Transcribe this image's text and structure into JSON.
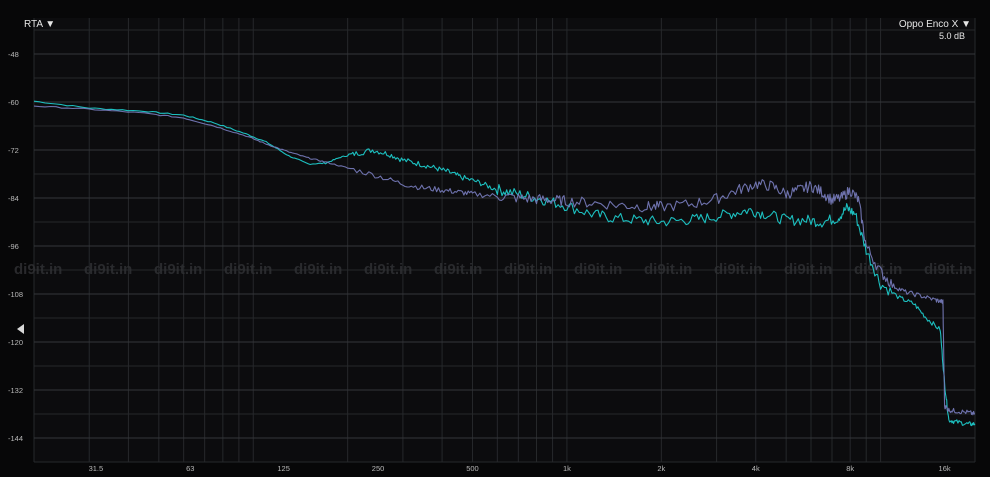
{
  "header": {
    "rta_label": "RTA ▼",
    "device_label": "Oppo Enco X ▼",
    "scale_label": "5.0 dB"
  },
  "watermark": {
    "text": "di9it.in"
  },
  "colors": {
    "background": "#070708",
    "grid": "#26282b",
    "series1": "#1ec9c9",
    "series2": "#7478b6",
    "tick_text": "#b8b8b8"
  },
  "chart_data": {
    "type": "line",
    "xscale": "log",
    "xlim": [
      20,
      20000
    ],
    "ylim": [
      -150,
      -39
    ],
    "grid": true,
    "x_ticks": [
      31.5,
      63,
      125,
      250,
      500,
      1000,
      2000,
      4000,
      8000,
      16000
    ],
    "x_tick_labels": [
      "31.5",
      "63",
      "125",
      "250",
      "500",
      "1k",
      "2k",
      "4k",
      "8k",
      "16k"
    ],
    "y_ticks": [
      -48,
      -60,
      -72,
      -84,
      -96,
      -108,
      -120,
      -132,
      -144
    ],
    "y_tick_labels": [
      "-48",
      "-60",
      "-72",
      "-84",
      "-96",
      "-108",
      "-120",
      "-132",
      "-144"
    ],
    "series": [
      {
        "color": "#1ec9c9",
        "x": [
          20,
          30,
          45,
          60,
          75,
          95,
          110,
          130,
          150,
          170,
          190,
          210,
          240,
          270,
          300,
          340,
          380,
          420,
          460,
          520,
          580,
          650,
          750,
          850,
          1000,
          1200,
          1400,
          1700,
          2000,
          2400,
          2800,
          3300,
          3800,
          4300,
          5000,
          5800,
          6500,
          7300,
          7800,
          8300,
          9000,
          10000,
          11500,
          12800,
          14000,
          15500,
          16000,
          16500,
          17500,
          19000,
          20000
        ],
        "y": [
          -59.8,
          -61.5,
          -62.3,
          -63.3,
          -65.2,
          -68.0,
          -70.0,
          -73.5,
          -75.5,
          -75.3,
          -73.8,
          -73.0,
          -72.0,
          -73.0,
          -74.5,
          -75.5,
          -76.5,
          -77.5,
          -78.8,
          -80.0,
          -81.5,
          -82.5,
          -83.5,
          -84.5,
          -86.0,
          -88.0,
          -89.0,
          -89.5,
          -90.0,
          -89.5,
          -89.0,
          -88.0,
          -87.0,
          -88.0,
          -89.5,
          -89.5,
          -90.0,
          -89.0,
          -86.5,
          -88.0,
          -97.0,
          -105.5,
          -109.0,
          -110.5,
          -114.0,
          -117.0,
          -130.5,
          -139.5,
          -140.0,
          -140.5,
          -140.5
        ]
      },
      {
        "color": "#7478b6",
        "x": [
          20,
          30,
          45,
          60,
          75,
          95,
          110,
          130,
          150,
          170,
          200,
          250,
          300,
          350,
          400,
          450,
          500,
          600,
          700,
          800,
          900,
          1000,
          1200,
          1500,
          1800,
          2000,
          2500,
          3000,
          3500,
          4000,
          4500,
          5000,
          5500,
          6000,
          6500,
          7000,
          7500,
          8000,
          8500,
          9000,
          10000,
          11000,
          12000,
          13500,
          15000,
          15800,
          16000,
          16500,
          17500,
          19000,
          20000
        ],
        "y": [
          -61.0,
          -61.8,
          -62.8,
          -64.0,
          -66.0,
          -68.5,
          -70.5,
          -72.5,
          -74.0,
          -75.0,
          -76.5,
          -78.5,
          -80.5,
          -81.5,
          -82.0,
          -82.5,
          -83.0,
          -83.5,
          -84.0,
          -84.3,
          -84.5,
          -84.8,
          -85.2,
          -85.8,
          -86.2,
          -86.2,
          -85.5,
          -84.2,
          -82.0,
          -80.5,
          -81.0,
          -83.0,
          -82.0,
          -81.0,
          -82.5,
          -84.5,
          -84.0,
          -82.0,
          -84.5,
          -96.0,
          -102.5,
          -106.0,
          -107.5,
          -108.5,
          -109.5,
          -110.0,
          -136.0,
          -137.0,
          -137.3,
          -137.6,
          -138.0
        ]
      }
    ]
  }
}
